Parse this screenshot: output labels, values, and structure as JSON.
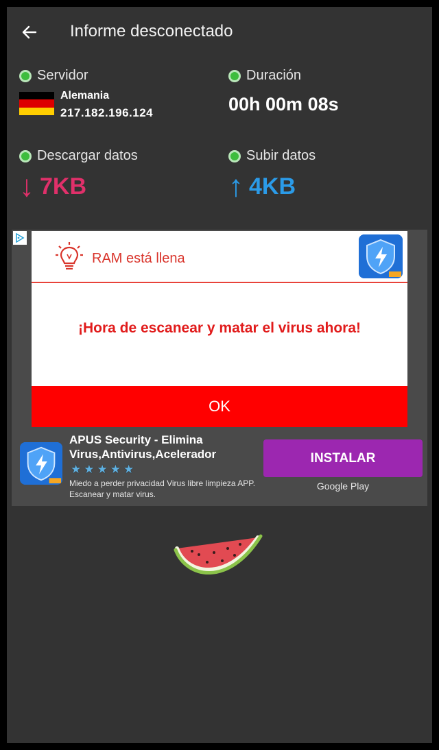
{
  "header": {
    "title": "Informe desconectado"
  },
  "server": {
    "label": "Servidor",
    "country": "Alemania",
    "ip": "217.182.196.124",
    "flag_colors": [
      "#000000",
      "#dd0000",
      "#ffce00"
    ]
  },
  "duration": {
    "label": "Duración",
    "value": "00h 00m 08s"
  },
  "download": {
    "label": "Descargar datos",
    "arrow": "↓",
    "value": "7KB",
    "color": "#e0306a"
  },
  "upload": {
    "label": "Subir datos",
    "arrow": "↑",
    "value": "4KB",
    "color": "#2b9be8"
  },
  "ad": {
    "creative": {
      "ram_text": "RAM está llena",
      "headline": "¡Hora de escanear y matar el virus ahora!",
      "ok_label": "OK"
    },
    "app_name": "APUS Security - Elimina Virus,Antivirus,Acelerador",
    "rating_stars": 5,
    "description": "Miedo a perder privacidad Virus libre limpieza APP. Escanear y matar virus.",
    "install_label": "INSTALAR",
    "store_label": "Google Play"
  },
  "colors": {
    "background": "#333333",
    "status_dot": "#3dbd3d",
    "install": "#9c27b0",
    "ok_button": "#ff0000"
  },
  "icons": [
    "back-arrow-icon",
    "status-dot-icon",
    "germany-flag-icon",
    "adchoices-icon",
    "lightbulb-icon",
    "shield-lightning-icon",
    "star-icon",
    "watermelon-icon"
  ]
}
